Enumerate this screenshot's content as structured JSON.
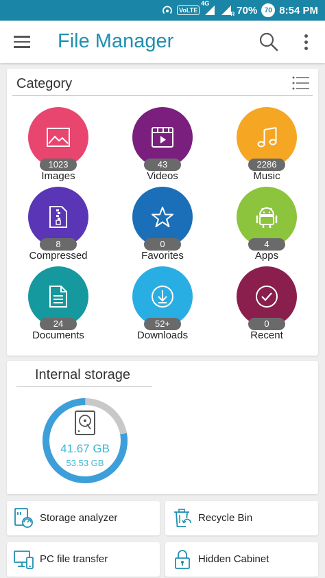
{
  "status_bar": {
    "network_label": "VoLTE",
    "network_type": "4G",
    "roaming": "R",
    "battery_percent": "70%",
    "battery_badge": "70",
    "time": "8:54 PM"
  },
  "app_bar": {
    "title": "File Manager"
  },
  "category": {
    "title": "Category",
    "items": [
      {
        "label": "Images",
        "count": "1023",
        "color": "#e8456f",
        "icon": "image-icon"
      },
      {
        "label": "Videos",
        "count": "43",
        "color": "#7a1f7e",
        "icon": "video-icon"
      },
      {
        "label": "Music",
        "count": "2286",
        "color": "#f5a623",
        "icon": "music-icon"
      },
      {
        "label": "Compressed",
        "count": "8",
        "color": "#5a35b5",
        "icon": "zip-icon"
      },
      {
        "label": "Favorites",
        "count": "0",
        "color": "#1b6fb8",
        "icon": "star-icon"
      },
      {
        "label": "Apps",
        "count": "4",
        "color": "#8cc43d",
        "icon": "android-icon"
      },
      {
        "label": "Documents",
        "count": "24",
        "color": "#16989f",
        "icon": "document-icon"
      },
      {
        "label": "Downloads",
        "count": "52+",
        "color": "#29aee3",
        "icon": "download-icon"
      },
      {
        "label": "Recent",
        "count": "0",
        "color": "#8a1f4d",
        "icon": "check-circle-icon"
      }
    ]
  },
  "storage": {
    "title": "Internal storage",
    "free": "41.67 GB",
    "total": "53.53 GB",
    "ring_color": "#3d9fd9",
    "ring_used_color": "#c8c8c8"
  },
  "tools": [
    {
      "label": "Storage analyzer",
      "icon": "storage-analyzer-icon"
    },
    {
      "label": "Recycle Bin",
      "icon": "recycle-bin-icon"
    },
    {
      "label": "PC file transfer",
      "icon": "pc-transfer-icon"
    },
    {
      "label": "Hidden Cabinet",
      "icon": "lock-icon"
    }
  ]
}
